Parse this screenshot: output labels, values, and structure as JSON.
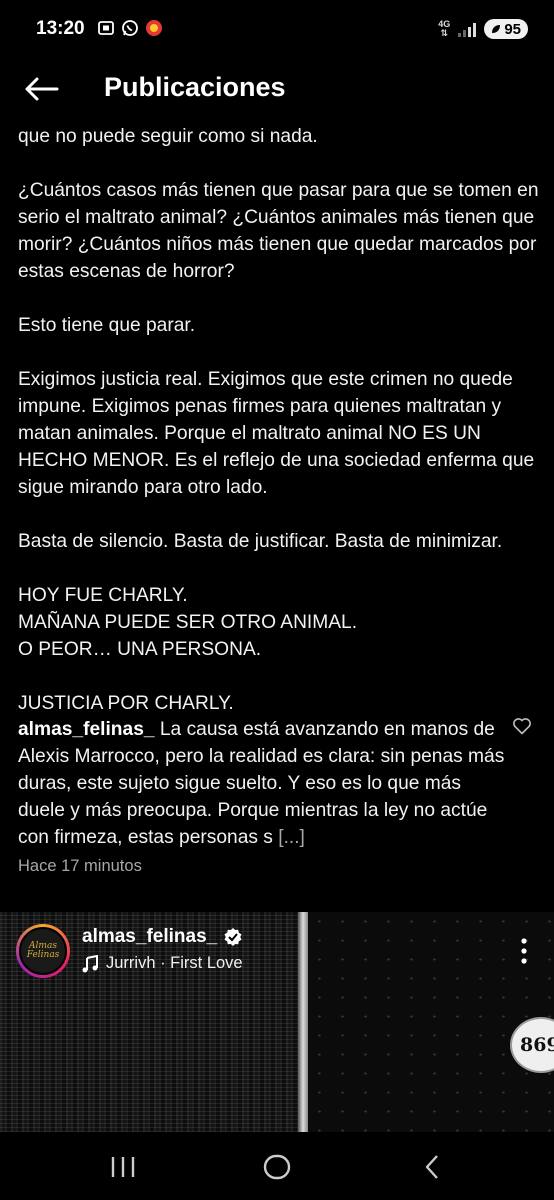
{
  "status": {
    "time": "13:20",
    "network": "4G",
    "battery": "95",
    "left_icons": [
      "screenshot-icon",
      "whatsapp-icon",
      "app-notification-icon"
    ]
  },
  "header": {
    "title": "Publicaciones"
  },
  "caption": {
    "paragraphs": [
      "que no puede seguir como si nada.",
      "¿Cuántos casos más tienen que pasar para que se tomen en serio el maltrato animal? ¿Cuántos animales más tienen que morir? ¿Cuántos niños más tienen que quedar marcados por estas escenas de horror?",
      "Esto tiene que parar.",
      "Exigimos justicia real. Exigimos que este crimen no quede impune. Exigimos penas firmes para quienes maltratan y matan animales. Porque el maltrato animal NO ES UN HECHO MENOR. Es el reflejo de una sociedad enferma que sigue mirando para otro lado.",
      "Basta de silencio. Basta de justificar. Basta de minimizar.",
      "HOY FUE CHARLY.\nMAÑANA PUEDE SER OTRO ANIMAL.\nO PEOR… UNA PERSONA.",
      "JUSTICIA POR CHARLY."
    ]
  },
  "comment": {
    "username": "almas_felinas_",
    "text": "La causa está avanzando en manos de Alexis Marrocco, pero la realidad es clara: sin penas más duras, este sujeto sigue suelto. Y eso es lo que más duele y más preocupa. Porque mientras la ley no actúe con firmeza, estas personas s",
    "more": "[...]",
    "time": "Hace 17 minutos"
  },
  "reel": {
    "username": "almas_felinas_",
    "music": "Jurrivh · First Love",
    "plate_number": "869",
    "avatar_text": "Almas Felinas"
  },
  "colors": {
    "background": "#000000",
    "text": "#f2f2f2",
    "muted": "#a8a8a8"
  }
}
